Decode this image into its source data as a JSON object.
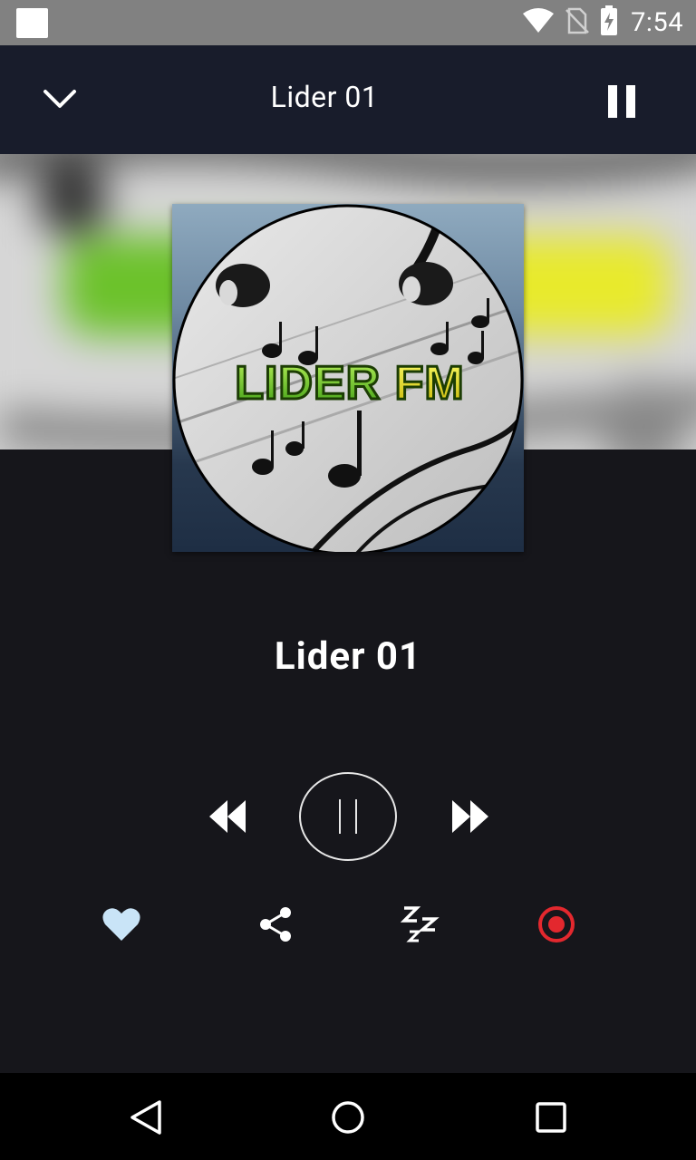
{
  "status_bar": {
    "time": "7:54",
    "icons": [
      "notification-square-icon",
      "wifi-icon",
      "no-sim-icon",
      "battery-charging-icon"
    ]
  },
  "toolbar": {
    "title": "Lider  01",
    "back_icon": "chevron-down-icon",
    "pause_icon": "pause-icon"
  },
  "artwork": {
    "logo_text": "LIDER FM",
    "description_icon": "station-artwork"
  },
  "player": {
    "station_name": "Lider  01",
    "controls": [
      "rewind-icon",
      "play-pause-icon",
      "fast-forward-icon"
    ]
  },
  "actions": {
    "favorite_icon": "heart-icon",
    "share_icon": "share-icon",
    "sleep_icon": "sleep-timer-icon",
    "record_icon": "record-icon"
  },
  "colors": {
    "toolbar_bg": "#181c2b",
    "body_bg": "#16161b",
    "status_bar_bg": "#818181",
    "favorite_color": "#c9e4f7",
    "record_color": "#e3282e"
  },
  "nav_bar": {
    "buttons": [
      "back-triangle-icon",
      "home-circle-icon",
      "recents-square-icon"
    ]
  }
}
